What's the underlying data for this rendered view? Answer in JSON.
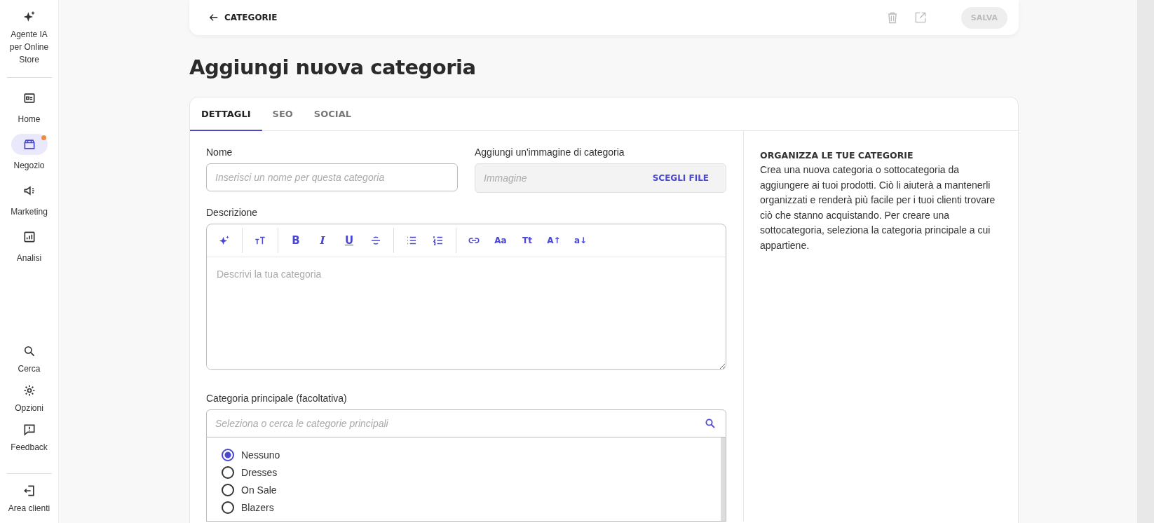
{
  "sidebar": {
    "agent": {
      "label": "Agente IA per Online Store"
    },
    "nav": [
      {
        "label": "Home",
        "selected": false,
        "dot": false
      },
      {
        "label": "Negozio",
        "selected": true,
        "dot": true
      },
      {
        "label": "Marketing",
        "selected": false,
        "dot": false
      },
      {
        "label": "Analisi",
        "selected": false,
        "dot": false
      }
    ],
    "bottom": [
      {
        "label": "Cerca"
      },
      {
        "label": "Opzioni"
      },
      {
        "label": "Feedback"
      }
    ],
    "footer": {
      "label": "Area clienti"
    }
  },
  "topbar": {
    "back_label": "CATEGORIE",
    "save_label": "SALVA",
    "save_disabled": true
  },
  "page_title": "Aggiungi nuova categoria",
  "tabs": [
    {
      "label": "DETTAGLI",
      "selected": true
    },
    {
      "label": "SEO",
      "selected": false
    },
    {
      "label": "SOCIAL",
      "selected": false
    }
  ],
  "form": {
    "name": {
      "label": "Nome",
      "placeholder": "Inserisci un nome per questa categoria"
    },
    "image": {
      "label": "Aggiungi un'immagine di categoria",
      "placeholder": "Immagine",
      "button": "SCEGLI FILE"
    },
    "description": {
      "label": "Descrizione",
      "placeholder": "Descrivi la tua categoria",
      "toolbar": [
        [
          {
            "kind": "sparkle"
          }
        ],
        [
          {
            "kind": "text-size"
          }
        ],
        [
          {
            "kind": "bold",
            "label": "B"
          },
          {
            "kind": "italic",
            "label": "I"
          },
          {
            "kind": "underline",
            "label": "U"
          },
          {
            "kind": "strike"
          }
        ],
        [
          {
            "kind": "bullets"
          },
          {
            "kind": "numbers"
          }
        ],
        [
          {
            "kind": "link"
          },
          {
            "kind": "text",
            "label": "Aa"
          },
          {
            "kind": "text",
            "label": "Tt"
          },
          {
            "kind": "text",
            "label": "A↑"
          },
          {
            "kind": "text",
            "label": "a↓"
          }
        ]
      ]
    },
    "parent": {
      "label": "Categoria principale (facoltativa)",
      "placeholder": "Seleziona o cerca le categorie principali",
      "options": [
        {
          "label": "Nessuno",
          "selected": true
        },
        {
          "label": "Dresses",
          "selected": false
        },
        {
          "label": "On Sale",
          "selected": false
        },
        {
          "label": "Blazers",
          "selected": false
        }
      ]
    }
  },
  "help": {
    "title": "ORGANIZZA LE TUE CATEGORIE",
    "text": "Crea una nuova categoria o sottocategoria da aggiungere ai tuoi prodotti. Ciò li aiuterà a mantenerli organizzati e renderà più facile per i tuoi clienti trovare ciò che stanno acquistando. Per creare una sottocategoria, seleziona la categoria principale a cui appartiene."
  }
}
